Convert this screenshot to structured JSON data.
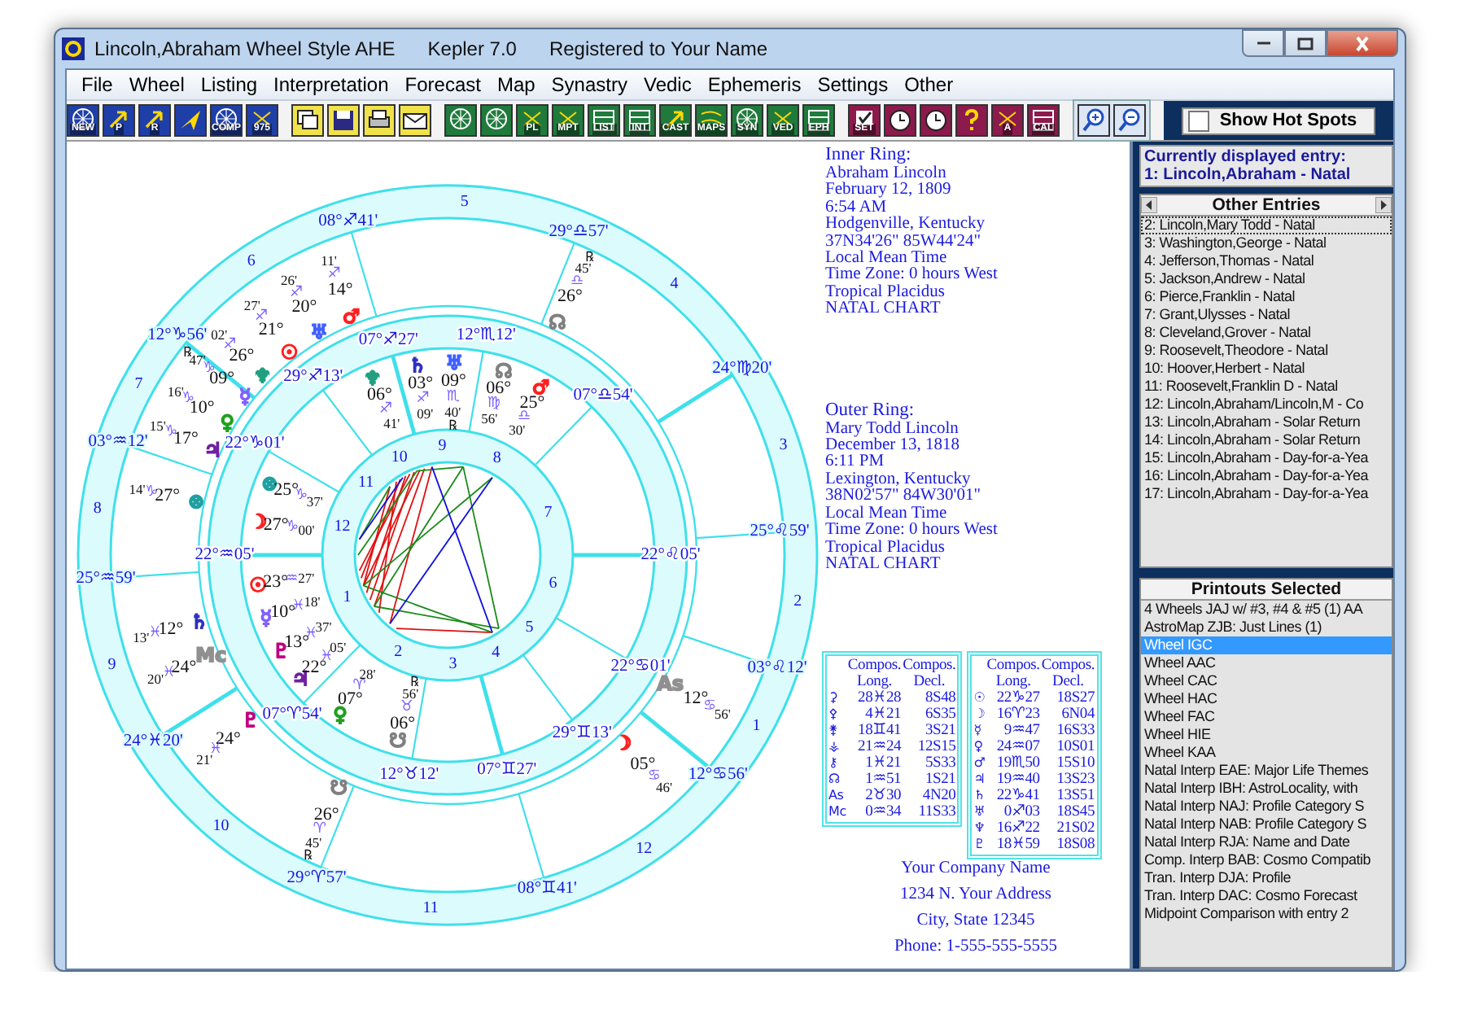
{
  "window": {
    "title": "Lincoln,Abraham Wheel Style AHE",
    "app": "Kepler 7.0",
    "registration": "Registered to Your Name"
  },
  "menu": [
    "File",
    "Wheel",
    "Listing",
    "Interpretation",
    "Forecast",
    "Map",
    "Synastry",
    "Vedic",
    "Ephemeris",
    "Settings",
    "Other"
  ],
  "toolbar": [
    [
      {
        "kind": "wheel",
        "label": "NEW"
      },
      {
        "kind": "arrow",
        "label": "P"
      },
      {
        "kind": "arrow",
        "label": "R"
      },
      {
        "kind": "plane"
      },
      {
        "kind": "wheel",
        "label": "COMP"
      },
      {
        "kind": "digits",
        "label": "975"
      }
    ],
    [
      {
        "kind": "windows"
      },
      {
        "kind": "save"
      },
      {
        "kind": "print"
      },
      {
        "kind": "mail"
      }
    ],
    [
      {
        "kind": "wheel"
      },
      {
        "kind": "wheel"
      },
      {
        "kind": "digits",
        "label": "PL"
      },
      {
        "kind": "digits",
        "label": "MPT"
      },
      {
        "kind": "list",
        "label": "LIST"
      },
      {
        "kind": "list",
        "label": "INT"
      },
      {
        "kind": "arrow",
        "label": "CAST"
      },
      {
        "kind": "map",
        "label": "MAPS"
      },
      {
        "kind": "wheel",
        "label": "SYN"
      },
      {
        "kind": "digits",
        "label": "VED"
      },
      {
        "kind": "list",
        "label": "EPH"
      }
    ],
    [
      {
        "kind": "check",
        "label": "SET"
      },
      {
        "kind": "clock"
      },
      {
        "kind": "clock"
      },
      {
        "kind": "help"
      },
      {
        "kind": "digits",
        "label": "A"
      },
      {
        "kind": "list",
        "label": "CAL"
      }
    ],
    [
      {
        "kind": "zoom-in"
      },
      {
        "kind": "zoom-out"
      }
    ]
  ],
  "hot_spots": {
    "label": "Show Hot Spots",
    "checked": false
  },
  "wheel": {
    "outer": {
      "cusps": [
        "08°♐41'",
        "29°♎57'",
        "12°♑56'",
        "24°♍20'",
        "03°♒12'",
        "25°♌59'",
        "25°♒59'",
        "03°♌12'",
        "24°♓20'",
        "12°♋56'",
        "29°♈57'",
        "08°♊41'"
      ],
      "house_numbers": [
        "5",
        "6",
        "4",
        "7",
        "3",
        "8",
        "2",
        "9",
        "1",
        "10",
        "12",
        "11"
      ],
      "planets": [
        {
          "symbol": "♂",
          "degree": "14°",
          "sign": "♐",
          "minute": "11'",
          "color": "#ff2020"
        },
        {
          "symbol": "☊",
          "degree": "26°",
          "sign": "♎",
          "minute": "45'",
          "flag": "℞",
          "color": "#808080"
        },
        {
          "symbol": "♅",
          "degree": "20°",
          "sign": "♐",
          "minute": "26'",
          "color": "#4060ff"
        },
        {
          "symbol": "☉",
          "degree": "21°",
          "sign": "♐",
          "minute": "27'",
          "color": "#ff2020"
        },
        {
          "symbol": "♆",
          "degree": "26°",
          "sign": "♐",
          "minute": "02'",
          "color": "#20a080"
        },
        {
          "symbol": "☿",
          "degree": "09°",
          "sign": "♑",
          "minute": "47'",
          "flag": "℞",
          "color": "#8060ff"
        },
        {
          "symbol": "♀",
          "degree": "10°",
          "sign": "♑",
          "minute": "16'",
          "color": "#20a020"
        },
        {
          "symbol": "♃",
          "degree": "17°",
          "sign": "♑",
          "minute": "15'",
          "color": "#7020a0"
        },
        {
          "symbol": "⊗",
          "degree": "27°",
          "sign": "♑",
          "minute": "14'",
          "color": "#20a0a0"
        },
        {
          "symbol": "♄",
          "degree": "12°",
          "sign": "♓",
          "minute": "13'",
          "color": "#3030c0"
        },
        {
          "symbol": "Mc",
          "degree": "24°",
          "sign": "♓",
          "minute": "20'",
          "color": "#909090"
        },
        {
          "symbol": "As",
          "degree": "12°",
          "sign": "♋",
          "minute": "56'",
          "color": "#909090"
        },
        {
          "symbol": "♇",
          "degree": "24°",
          "sign": "♓",
          "minute": "21'",
          "color": "#c00080"
        },
        {
          "symbol": "☽",
          "degree": "05°",
          "sign": "♋",
          "minute": "46'",
          "color": "#ff2020"
        },
        {
          "symbol": "☋",
          "degree": "26°",
          "sign": "♈",
          "minute": "45'",
          "flag": "℞",
          "color": "#808080"
        }
      ]
    },
    "inner": {
      "cusps": [
        "07°♐27'",
        "12°♏12'",
        "29°♐13'",
        "07°♎54'",
        "22°♑01'",
        "22°♒05'",
        "22°♌05'",
        "22°♋01'",
        "07°♈54'",
        "29°♊13'",
        "12°♉12'",
        "07°♊27'"
      ],
      "house_numbers": [
        "9",
        "10",
        "8",
        "11",
        "7",
        "12",
        "6",
        "1",
        "5",
        "2",
        "4",
        "3"
      ],
      "planets": [
        {
          "symbol": "♆",
          "degree": "06°",
          "sign": "♐",
          "minute": "41'",
          "color": "#20a080"
        },
        {
          "symbol": "♄",
          "degree": "03°",
          "sign": "♐",
          "minute": "09'",
          "color": "#3030c0"
        },
        {
          "symbol": "♅",
          "degree": "09°",
          "sign": "♏",
          "minute": "40'",
          "flag": "℞",
          "color": "#4060ff"
        },
        {
          "symbol": "☊",
          "degree": "06°",
          "sign": "♍",
          "minute": "56'",
          "color": "#808080"
        },
        {
          "symbol": "♂",
          "degree": "25°",
          "sign": "♎",
          "minute": "30'",
          "color": "#ff2020"
        },
        {
          "symbol": "⊗",
          "degree": "25°",
          "sign": "♑",
          "minute": "37'",
          "color": "#20a0a0"
        },
        {
          "symbol": "☽",
          "degree": "27°",
          "sign": "♑",
          "minute": "00'",
          "color": "#ff2020"
        },
        {
          "symbol": "☉",
          "degree": "23°",
          "sign": "♒",
          "minute": "27'",
          "color": "#ff2020"
        },
        {
          "symbol": "☿",
          "degree": "10°",
          "sign": "♓",
          "minute": "18'",
          "color": "#8060ff"
        },
        {
          "symbol": "♇",
          "degree": "13°",
          "sign": "♓",
          "minute": "37'",
          "color": "#c00080"
        },
        {
          "symbol": "♃",
          "degree": "22°",
          "sign": "♓",
          "minute": "05'",
          "color": "#7020a0"
        },
        {
          "symbol": "♀",
          "degree": "07°",
          "sign": "♈",
          "minute": "28'",
          "color": "#20a020"
        },
        {
          "symbol": "☋",
          "degree": "06°",
          "sign": "♉",
          "minute": "56'",
          "flag": "℞",
          "color": "#808080"
        }
      ]
    }
  },
  "inner_ring_info": {
    "heading": "Inner Ring:",
    "lines": [
      "Abraham Lincoln",
      "February 12, 1809",
      "6:54 AM",
      "Hodgenville, Kentucky",
      "37N34'26\"  85W44'24\"",
      "Local Mean Time",
      "Time Zone: 0 hours West",
      "Tropical Placidus",
      "NATAL CHART"
    ]
  },
  "outer_ring_info": {
    "heading": "Outer Ring:",
    "lines": [
      "Mary Todd Lincoln",
      "December 13, 1818",
      "6:11 PM",
      "Lexington, Kentucky",
      "38N02'57\"  84W30'01\"",
      "Local Mean Time",
      "Time Zone: 0 hours West",
      "Tropical Placidus",
      "NATAL CHART"
    ]
  },
  "tables": [
    {
      "columns": [
        {
          "title": "Compos.",
          "subtitle": "Long."
        },
        {
          "title": "Compos.",
          "subtitle": "Decl."
        }
      ],
      "rows": [
        {
          "point": "⚳",
          "long": "28♓28",
          "decl": "8S48"
        },
        {
          "point": "⚴",
          "long": "4♓21",
          "decl": "6S35"
        },
        {
          "point": "⚵",
          "long": "18♊41",
          "decl": "3S21"
        },
        {
          "point": "⚶",
          "long": "21♒24",
          "decl": "12S15"
        },
        {
          "point": "⚷",
          "long": "1♓21",
          "decl": "5S33"
        },
        {
          "point": "☊",
          "long": "1♒51",
          "decl": "1S21"
        },
        {
          "point": "As",
          "long": "2♉30",
          "decl": "4N20"
        },
        {
          "point": "Mc",
          "long": "0♒34",
          "decl": "11S33"
        }
      ]
    },
    {
      "columns": [
        {
          "title": "Compos.",
          "subtitle": "Long."
        },
        {
          "title": "Compos.",
          "subtitle": "Decl."
        }
      ],
      "rows": [
        {
          "point": "☉",
          "long": "22♑27",
          "decl": "18S27"
        },
        {
          "point": "☽",
          "long": "16♈23",
          "decl": "6N04"
        },
        {
          "point": "☿",
          "long": "9♒47",
          "decl": "16S33"
        },
        {
          "point": "♀",
          "long": "24♒07",
          "decl": "10S01"
        },
        {
          "point": "♂",
          "long": "19♏50",
          "decl": "15S10"
        },
        {
          "point": "♃",
          "long": "19♒40",
          "decl": "13S23"
        },
        {
          "point": "♄",
          "long": "22♑41",
          "decl": "13S51"
        },
        {
          "point": "♅",
          "long": "0♐03",
          "decl": "18S45"
        },
        {
          "point": "♆",
          "long": "16♐22",
          "decl": "21S02"
        },
        {
          "point": "♇",
          "long": "18♓59",
          "decl": "18S08"
        }
      ]
    }
  ],
  "address": [
    "Your Company Name",
    "1234 N. Your Address",
    "City, State 12345",
    "Phone: 1-555-555-5555"
  ],
  "current_entry": {
    "heading": "Currently displayed entry:",
    "value": "1: Lincoln,Abraham - Natal"
  },
  "other_entries": {
    "title": "Other Entries",
    "items": [
      {
        "label": "2: Lincoln,Mary Todd - Natal",
        "selected": true
      },
      {
        "label": "3: Washington,George - Natal",
        "selected": false
      },
      {
        "label": "4: Jefferson,Thomas - Natal",
        "selected": false
      },
      {
        "label": "5: Jackson,Andrew - Natal",
        "selected": false
      },
      {
        "label": "6: Pierce,Franklin - Natal",
        "selected": false
      },
      {
        "label": "7: Grant,Ulysses - Natal",
        "selected": false
      },
      {
        "label": "8: Cleveland,Grover - Natal",
        "selected": false
      },
      {
        "label": "9: Roosevelt,Theodore - Natal",
        "selected": false
      },
      {
        "label": "10: Hoover,Herbert - Natal",
        "selected": false
      },
      {
        "label": "11: Roosevelt,Franklin D - Natal",
        "selected": false
      },
      {
        "label": "12: Lincoln,Abraham/Lincoln,M - Co",
        "selected": false
      },
      {
        "label": "13: Lincoln,Abraham - Solar Return",
        "selected": false
      },
      {
        "label": "14: Lincoln,Abraham - Solar Return",
        "selected": false
      },
      {
        "label": "15: Lincoln,Abraham - Day-for-a-Yea",
        "selected": false
      },
      {
        "label": "16: Lincoln,Abraham - Day-for-a-Yea",
        "selected": false
      },
      {
        "label": "17: Lincoln,Abraham - Day-for-a-Yea",
        "selected": false
      }
    ]
  },
  "printouts": {
    "title": "Printouts Selected",
    "items": [
      {
        "label": "4 Wheels JAJ w/ #3, #4 & #5 (1) AA",
        "selected": false
      },
      {
        "label": "AstroMap ZJB: Just Lines (1)",
        "selected": false
      },
      {
        "label": "Wheel IGC",
        "selected": true
      },
      {
        "label": "Wheel AAC",
        "selected": false
      },
      {
        "label": "Wheel CAC",
        "selected": false
      },
      {
        "label": "Wheel HAC",
        "selected": false
      },
      {
        "label": "Wheel FAC",
        "selected": false
      },
      {
        "label": "Wheel HIE",
        "selected": false
      },
      {
        "label": "Wheel KAA",
        "selected": false
      },
      {
        "label": "Natal Interp EAE: Major Life Themes",
        "selected": false
      },
      {
        "label": "Natal Interp IBH: AstroLocality, with",
        "selected": false
      },
      {
        "label": "Natal Interp NAJ: Profile Category S",
        "selected": false
      },
      {
        "label": "Natal Interp NAB: Profile Category S",
        "selected": false
      },
      {
        "label": "Natal Interp RJA: Name and Date",
        "selected": false
      },
      {
        "label": "Comp. Interp BAB: Cosmo Compatib",
        "selected": false
      },
      {
        "label": "Tran. Interp DJA: Profile",
        "selected": false
      },
      {
        "label": "Tran. Interp DAC: Cosmo Forecast",
        "selected": false
      },
      {
        "label": "Midpoint Comparison  with entry 2",
        "selected": false
      }
    ]
  }
}
